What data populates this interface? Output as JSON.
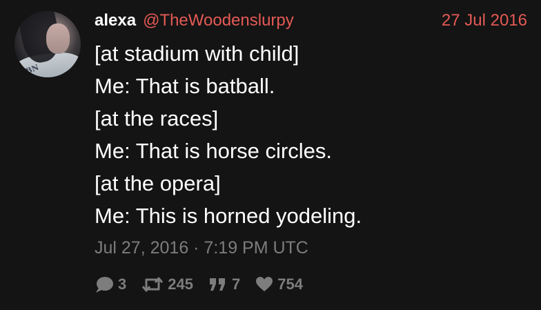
{
  "author": {
    "display_name": "alexa",
    "handle": "@TheWoodenslurpy",
    "avatar_shirt_text": "BN"
  },
  "date_short": "27 Jul 2016",
  "lines": [
    "[at stadium with child]",
    "Me: That is batball.",
    "[at the races]",
    "Me: That is horse circles.",
    "[at the opera]",
    "Me: This is horned yodeling."
  ],
  "timestamp": "Jul 27, 2016 · 7:19 PM UTC",
  "stats": {
    "replies": "3",
    "retweets": "245",
    "quotes": "7",
    "likes": "754"
  },
  "colors": {
    "background": "#141414",
    "accent": "#e45a55",
    "muted": "#7d7d7d",
    "text": "#ffffff"
  },
  "icons": [
    "comment-icon",
    "retweet-icon",
    "quote-icon",
    "heart-icon"
  ]
}
